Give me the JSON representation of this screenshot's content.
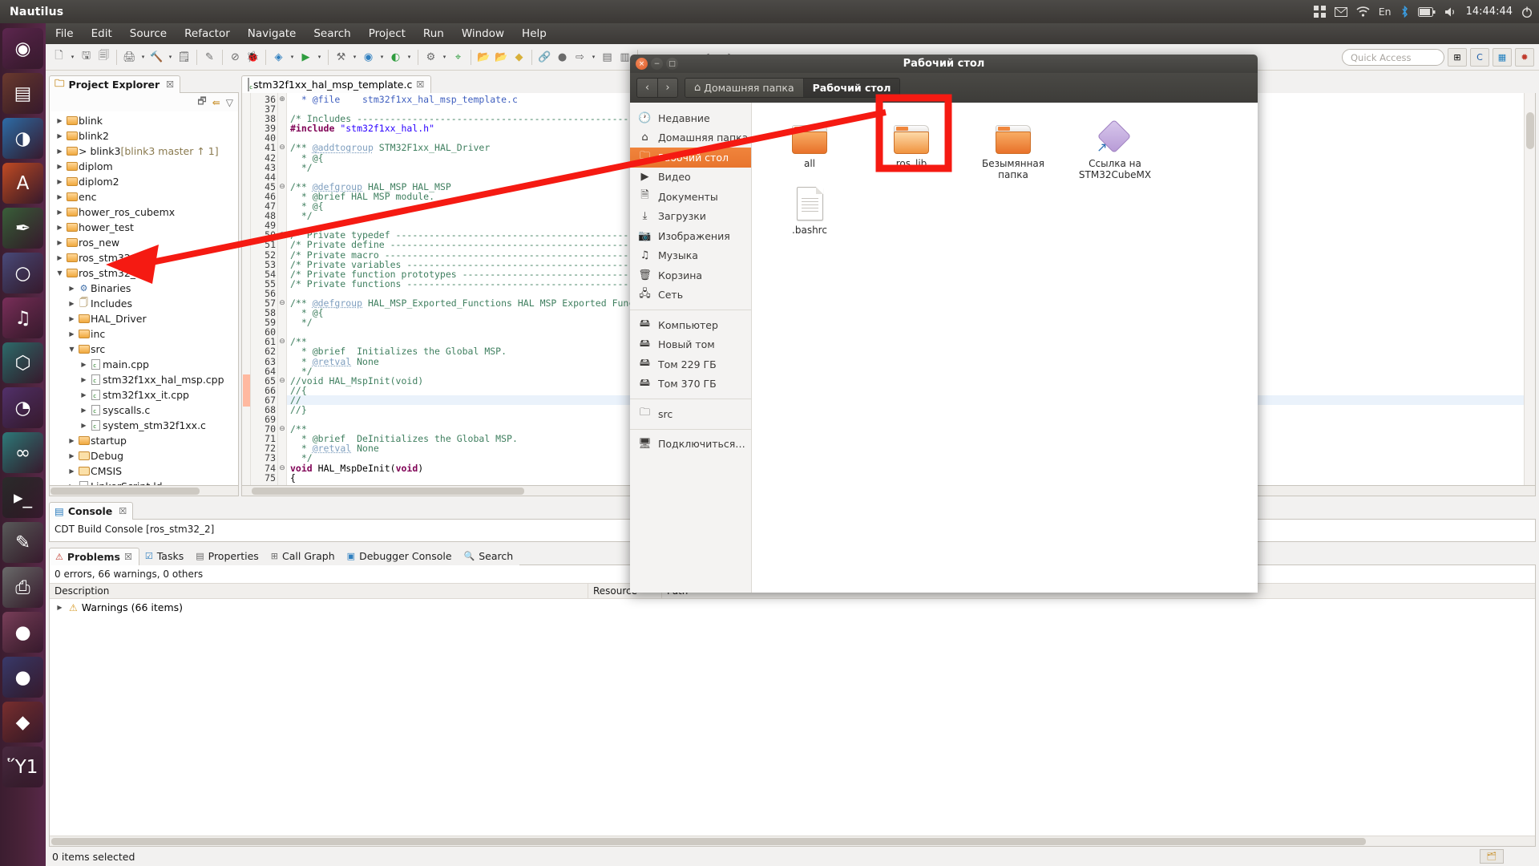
{
  "top_panel": {
    "app_title": "Nautilus",
    "clock": "14:44:44",
    "keyboard_layout": "En",
    "indicators": [
      "grid-icon",
      "envelope-icon",
      "wifi-icon",
      "keyboard-layout",
      "bluetooth-icon",
      "battery-icon",
      "volume-icon",
      "clock",
      "power-icon"
    ]
  },
  "launcher": {
    "items": [
      {
        "name": "ubuntu-dash",
        "glyph": "◉"
      },
      {
        "name": "files-nautilus",
        "glyph": "▤"
      },
      {
        "name": "firefox",
        "glyph": "◑"
      },
      {
        "name": "libreoffice-writer",
        "glyph": "A"
      },
      {
        "name": "gimp",
        "glyph": "✒"
      },
      {
        "name": "chromium",
        "glyph": "○"
      },
      {
        "name": "music-player",
        "glyph": "♫"
      },
      {
        "name": "virtualbox",
        "glyph": "⬡"
      },
      {
        "name": "blender",
        "glyph": "◔"
      },
      {
        "name": "arduino-ide",
        "glyph": "∞"
      },
      {
        "name": "terminal",
        "glyph": "▸_"
      },
      {
        "name": "text-editor",
        "glyph": "✎"
      },
      {
        "name": "printer",
        "glyph": "⎙"
      },
      {
        "name": "disk-1",
        "glyph": "●"
      },
      {
        "name": "disk-2",
        "glyph": "●"
      },
      {
        "name": "eclipse",
        "glyph": "◆"
      },
      {
        "name": "trash",
        "glyph": "Ὕ1"
      }
    ]
  },
  "eclipse": {
    "menubar": [
      "File",
      "Edit",
      "Source",
      "Refactor",
      "Navigate",
      "Search",
      "Project",
      "Run",
      "Window",
      "Help"
    ],
    "quick_access_placeholder": "Quick Access",
    "project_explorer": {
      "tab_label": "Project Explorer",
      "close_glyph": "☒",
      "nodes": [
        {
          "indent": 0,
          "twisty": "▶",
          "icon": "project-folder",
          "label": "blink",
          "decoration": "",
          "warn": false
        },
        {
          "indent": 0,
          "twisty": "▶",
          "icon": "project-folder",
          "label": "blink2",
          "decoration": "",
          "warn": true
        },
        {
          "indent": 0,
          "twisty": "▶",
          "icon": "project-folder",
          "label": "> blink3",
          "decoration": "[blink3 master ↑ 1]",
          "warn": true
        },
        {
          "indent": 0,
          "twisty": "▶",
          "icon": "project-folder",
          "label": "diplom",
          "decoration": "",
          "warn": false
        },
        {
          "indent": 0,
          "twisty": "▶",
          "icon": "project-folder",
          "label": "diplom2",
          "decoration": "",
          "warn": true
        },
        {
          "indent": 0,
          "twisty": "▶",
          "icon": "project-folder",
          "label": "enc",
          "decoration": "",
          "warn": false
        },
        {
          "indent": 0,
          "twisty": "▶",
          "icon": "project-folder",
          "label": "hower_ros_cubemx",
          "decoration": "",
          "warn": false
        },
        {
          "indent": 0,
          "twisty": "▶",
          "icon": "project-folder",
          "label": "hower_test",
          "decoration": "",
          "warn": true
        },
        {
          "indent": 0,
          "twisty": "▶",
          "icon": "project-folder",
          "label": "ros_new",
          "decoration": "",
          "warn": true
        },
        {
          "indent": 0,
          "twisty": "▶",
          "icon": "project-folder",
          "label": "ros_stm32",
          "decoration": "",
          "warn": false
        },
        {
          "indent": 0,
          "twisty": "▼",
          "icon": "project-folder",
          "label": "ros_stm32_2",
          "decoration": "",
          "warn": false
        },
        {
          "indent": 1,
          "twisty": "▶",
          "icon": "binaries",
          "label": "Binaries",
          "decoration": "",
          "warn": false
        },
        {
          "indent": 1,
          "twisty": "▶",
          "icon": "includes",
          "label": "Includes",
          "decoration": "",
          "warn": false
        },
        {
          "indent": 1,
          "twisty": "▶",
          "icon": "src-folder",
          "label": "HAL_Driver",
          "decoration": "",
          "warn": false
        },
        {
          "indent": 1,
          "twisty": "▶",
          "icon": "src-folder",
          "label": "inc",
          "decoration": "",
          "warn": false
        },
        {
          "indent": 1,
          "twisty": "▼",
          "icon": "src-folder",
          "label": "src",
          "decoration": "",
          "warn": false
        },
        {
          "indent": 2,
          "twisty": "▶",
          "icon": "c-file",
          "label": "main.cpp",
          "decoration": "",
          "warn": false
        },
        {
          "indent": 2,
          "twisty": "▶",
          "icon": "c-file",
          "label": "stm32f1xx_hal_msp.cpp",
          "decoration": "",
          "warn": false
        },
        {
          "indent": 2,
          "twisty": "▶",
          "icon": "c-file",
          "label": "stm32f1xx_it.cpp",
          "decoration": "",
          "warn": false
        },
        {
          "indent": 2,
          "twisty": "▶",
          "icon": "c-file",
          "label": "syscalls.c",
          "decoration": "",
          "warn": false
        },
        {
          "indent": 2,
          "twisty": "▶",
          "icon": "c-file",
          "label": "system_stm32f1xx.c",
          "decoration": "",
          "warn": false
        },
        {
          "indent": 1,
          "twisty": "▶",
          "icon": "src-folder",
          "label": "startup",
          "decoration": "",
          "warn": false
        },
        {
          "indent": 1,
          "twisty": "▶",
          "icon": "plain-folder",
          "label": "Debug",
          "decoration": "",
          "warn": false
        },
        {
          "indent": 1,
          "twisty": "▶",
          "icon": "plain-folder",
          "label": "CMSIS",
          "decoration": "",
          "warn": false
        },
        {
          "indent": 1,
          "twisty": "▶",
          "icon": "ld-file",
          "label": "LinkerScript.ld",
          "decoration": "",
          "warn": false
        }
      ]
    },
    "editor": {
      "tab_label": "stm32f1xx_hal_msp_template.c",
      "close_glyph": "☒",
      "lines": [
        {
          "num": "36",
          "fold": "⊕",
          "html": "<span class='c-doc'>  * @file    stm32f1xx_hal_msp_template.c</span>"
        },
        {
          "num": "37",
          "fold": "",
          "html": ""
        },
        {
          "num": "38",
          "fold": "",
          "html": "<span class='c-cm'>/* Includes ------------------------------------------------------------------*/</span>"
        },
        {
          "num": "39",
          "fold": "",
          "html": "<span class='c-pp'>#include</span> <span class='c-str'>\"stm32f1xx_hal.h\"</span>"
        },
        {
          "num": "40",
          "fold": "",
          "html": ""
        },
        {
          "num": "41",
          "fold": "⊖",
          "html": "<span class='c-cm'>/** </span><span class='c-tag'>@addtogroup</span><span class='c-cm'> STM32F1xx_HAL_Driver</span>"
        },
        {
          "num": "42",
          "fold": "",
          "html": "<span class='c-cm'>  * @{</span>"
        },
        {
          "num": "43",
          "fold": "",
          "html": "<span class='c-cm'>  */</span>"
        },
        {
          "num": "44",
          "fold": "",
          "html": ""
        },
        {
          "num": "45",
          "fold": "⊖",
          "html": "<span class='c-cm'>/** </span><span class='c-tag'>@defgroup</span><span class='c-cm'> HAL_MSP HAL_MSP</span>"
        },
        {
          "num": "46",
          "fold": "",
          "html": "<span class='c-cm'>  * @brief HAL MSP module.</span>"
        },
        {
          "num": "47",
          "fold": "",
          "html": "<span class='c-cm'>  * @{</span>"
        },
        {
          "num": "48",
          "fold": "",
          "html": "<span class='c-cm'>  */</span>"
        },
        {
          "num": "49",
          "fold": "",
          "html": ""
        },
        {
          "num": "50",
          "fold": "⊖",
          "html": "<span class='c-cm'>/* Private typedef -----------------------------------------------------------*/</span>"
        },
        {
          "num": "51",
          "fold": "",
          "html": "<span class='c-cm'>/* Private define ------------------------------------------------------------*/</span>"
        },
        {
          "num": "52",
          "fold": "",
          "html": "<span class='c-cm'>/* Private macro -------------------------------------------------------------*/</span>"
        },
        {
          "num": "53",
          "fold": "",
          "html": "<span class='c-cm'>/* Private variables ---------------------------------------------------------*/</span>"
        },
        {
          "num": "54",
          "fold": "",
          "html": "<span class='c-cm'>/* Private function prototypes -----------------------------------------------*/</span>"
        },
        {
          "num": "55",
          "fold": "",
          "html": "<span class='c-cm'>/* Private functions ---------------------------------------------------------*/</span>"
        },
        {
          "num": "56",
          "fold": "",
          "html": ""
        },
        {
          "num": "57",
          "fold": "⊖",
          "html": "<span class='c-cm'>/** </span><span class='c-tag'>@defgroup</span><span class='c-cm'> HAL_MSP_Exported_Functions HAL MSP Exported Functions</span>"
        },
        {
          "num": "58",
          "fold": "",
          "html": "<span class='c-cm'>  * @{</span>"
        },
        {
          "num": "59",
          "fold": "",
          "html": "<span class='c-cm'>  */</span>"
        },
        {
          "num": "60",
          "fold": "",
          "html": ""
        },
        {
          "num": "61",
          "fold": "⊖",
          "html": "<span class='c-cm'>/**</span>"
        },
        {
          "num": "62",
          "fold": "",
          "html": "<span class='c-cm'>  * @brief  Initializes the Global MSP.</span>"
        },
        {
          "num": "63",
          "fold": "",
          "html": "<span class='c-cm'>  * </span><span class='c-tag'>@retval</span><span class='c-cm'> None</span>"
        },
        {
          "num": "64",
          "fold": "",
          "html": "<span class='c-cm'>  */</span>"
        },
        {
          "num": "65",
          "fold": "⊖",
          "html": "<span class='c-cm'>//void HAL_MspInit(void)</span>"
        },
        {
          "num": "66",
          "fold": "",
          "html": "<span class='c-cm'>//{</span>"
        },
        {
          "num": "67",
          "fold": "",
          "html": "<span class='c-cm'>//</span>",
          "highlight": true
        },
        {
          "num": "68",
          "fold": "",
          "html": "<span class='c-cm'>//}</span>"
        },
        {
          "num": "69",
          "fold": "",
          "html": ""
        },
        {
          "num": "70",
          "fold": "⊖",
          "html": "<span class='c-cm'>/**</span>"
        },
        {
          "num": "71",
          "fold": "",
          "html": "<span class='c-cm'>  * @brief  DeInitializes the Global MSP.</span>"
        },
        {
          "num": "72",
          "fold": "",
          "html": "<span class='c-cm'>  * </span><span class='c-tag'>@retval</span><span class='c-cm'> None</span>"
        },
        {
          "num": "73",
          "fold": "",
          "html": "<span class='c-cm'>  */</span>"
        },
        {
          "num": "74",
          "fold": "⊖",
          "html": "<span class='c-kw'>void</span> <span class='c-pl'>HAL_MspDeInit(</span><span class='c-kw'>void</span><span class='c-pl'>)</span>"
        },
        {
          "num": "75",
          "fold": "",
          "html": "<span class='c-pl'>{</span>"
        }
      ]
    },
    "console": {
      "tab_label": "Console",
      "close_glyph": "☒",
      "content": "CDT Build Console [ros_stm32_2]"
    },
    "problems": {
      "tabs": [
        {
          "label": "Problems",
          "active": true,
          "icon": "problems-icon"
        },
        {
          "label": "Tasks",
          "active": false,
          "icon": "tasks-icon"
        },
        {
          "label": "Properties",
          "active": false,
          "icon": "properties-icon"
        },
        {
          "label": "Call Graph",
          "active": false,
          "icon": "callgraph-icon"
        },
        {
          "label": "Debugger Console",
          "active": false,
          "icon": "debugger-icon"
        },
        {
          "label": "Search",
          "active": false,
          "icon": "search-icon"
        }
      ],
      "close_glyph": "☒",
      "summary": "0 errors, 66 warnings, 0 others",
      "columns": [
        "Description",
        "Resource",
        "Path"
      ],
      "rows": [
        {
          "twisty": "▶",
          "icon": "warning-icon",
          "description": "Warnings (66 items)",
          "resource": "",
          "path": ""
        }
      ]
    },
    "statusbar": {
      "text": "0 items selected"
    }
  },
  "nautilus": {
    "title": "Рабочий стол",
    "window_buttons": {
      "close": "×",
      "minimize": "−",
      "maximize": "□"
    },
    "nav": {
      "back": "‹",
      "forward": "›"
    },
    "breadcrumbs": [
      {
        "label": "Домашняя папка",
        "icon": "home-icon",
        "active": false
      },
      {
        "label": "Рабочий стол",
        "icon": "",
        "active": true
      }
    ],
    "sidebar": [
      {
        "label": "Недавние",
        "icon": "clock-icon",
        "active": false,
        "sep_after": false
      },
      {
        "label": "Домашняя папка",
        "icon": "home-icon",
        "active": false,
        "sep_after": false
      },
      {
        "label": "Рабочий стол",
        "icon": "folder-icon",
        "active": true,
        "sep_after": false
      },
      {
        "label": "Видео",
        "icon": "video-icon",
        "active": false,
        "sep_after": false
      },
      {
        "label": "Документы",
        "icon": "document-icon",
        "active": false,
        "sep_after": false
      },
      {
        "label": "Загрузки",
        "icon": "download-icon",
        "active": false,
        "sep_after": false
      },
      {
        "label": "Изображения",
        "icon": "camera-icon",
        "active": false,
        "sep_after": false
      },
      {
        "label": "Музыка",
        "icon": "music-icon",
        "active": false,
        "sep_after": false
      },
      {
        "label": "Корзина",
        "icon": "trash-icon",
        "active": false,
        "sep_after": false
      },
      {
        "label": "Сеть",
        "icon": "network-icon",
        "active": false,
        "sep_after": true
      },
      {
        "label": "Компьютер",
        "icon": "disk-icon",
        "active": false,
        "sep_after": false
      },
      {
        "label": "Новый том",
        "icon": "disk-icon",
        "active": false,
        "sep_after": false
      },
      {
        "label": "Том 229 ГБ",
        "icon": "disk-icon",
        "active": false,
        "sep_after": false
      },
      {
        "label": "Том 370 ГБ",
        "icon": "disk-icon",
        "active": false,
        "sep_after": true
      },
      {
        "label": "src",
        "icon": "folder-icon",
        "active": false,
        "sep_after": true
      },
      {
        "label": "Подключиться…",
        "icon": "connect-icon",
        "active": false,
        "sep_after": false
      }
    ],
    "files": [
      {
        "label": "all",
        "icon": "folder",
        "highlighted": false
      },
      {
        "label": "ros_lib",
        "icon": "folder-light",
        "highlighted": true
      },
      {
        "label": "Безымянная папка",
        "icon": "folder",
        "highlighted": false
      },
      {
        "label": "Ссылка на STM32CubeMX",
        "icon": "cubemx-link",
        "highlighted": false
      },
      {
        "label": ".bashrc",
        "icon": "text-file",
        "highlighted": false
      }
    ]
  },
  "annotation": {
    "color": "#f51a12",
    "description": "red arrow from ros_lib folder to ros_stm32_2 project node, with red rectangle around ros_lib"
  }
}
